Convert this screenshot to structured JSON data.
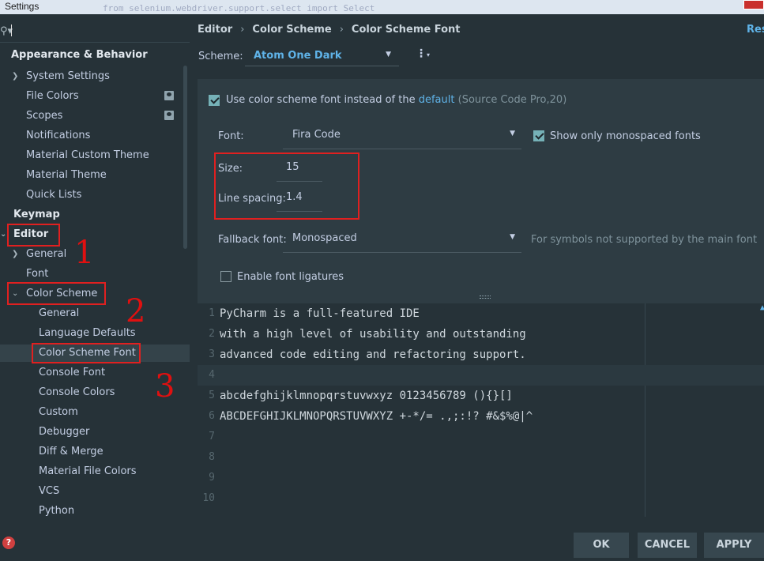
{
  "window": {
    "title": "Settings",
    "background_code": "from selenium.webdriver.support.select import Select"
  },
  "search": {
    "value": "",
    "icon": "search-icon"
  },
  "sidebar": {
    "items": [
      {
        "label": "Appearance & Behavior"
      },
      {
        "label": "System Settings"
      },
      {
        "label": "File Colors"
      },
      {
        "label": "Scopes"
      },
      {
        "label": "Notifications"
      },
      {
        "label": "Material Custom Theme"
      },
      {
        "label": "Material Theme"
      },
      {
        "label": "Quick Lists"
      },
      {
        "label": "Keymap"
      },
      {
        "label": "Editor"
      },
      {
        "label": "General"
      },
      {
        "label": "Font"
      },
      {
        "label": "Color Scheme"
      },
      {
        "label": "General"
      },
      {
        "label": "Language Defaults"
      },
      {
        "label": "Color Scheme Font"
      },
      {
        "label": "Console Font"
      },
      {
        "label": "Console Colors"
      },
      {
        "label": "Custom"
      },
      {
        "label": "Debugger"
      },
      {
        "label": "Diff & Merge"
      },
      {
        "label": "Material File Colors"
      },
      {
        "label": "VCS"
      },
      {
        "label": "Python"
      }
    ]
  },
  "annotations": [
    "1",
    "2",
    "3"
  ],
  "breadcrumb": {
    "items": [
      "Editor",
      "Color Scheme",
      "Color Scheme Font"
    ],
    "separator": "›"
  },
  "reset_label": "Res",
  "scheme": {
    "label": "Scheme:",
    "value": "Atom One Dark"
  },
  "use_scheme_font": {
    "checked": true,
    "text_before": "Use color scheme font instead of the",
    "link": "default",
    "text_after": "(Source Code Pro,20)"
  },
  "font": {
    "label": "Font:",
    "value": "Fira Code"
  },
  "show_monospaced": {
    "checked": true,
    "label": "Show only monospaced fonts"
  },
  "size": {
    "label": "Size:",
    "value": "15"
  },
  "line_spacing": {
    "label": "Line spacing:",
    "value": "1.4"
  },
  "fallback": {
    "label": "Fallback font:",
    "value": "Monospaced",
    "hint": "For symbols not supported by the main font"
  },
  "ligatures": {
    "checked": false,
    "label": "Enable font ligatures"
  },
  "preview": {
    "lines": [
      {
        "num": "1",
        "text": "PyCharm is a full-featured IDE"
      },
      {
        "num": "2",
        "text": "with a high level of usability and outstanding"
      },
      {
        "num": "3",
        "text": "advanced code editing and refactoring support."
      },
      {
        "num": "4",
        "text": ""
      },
      {
        "num": "5",
        "text": "abcdefghijklmnopqrstuvwxyz 0123456789 (){}[]"
      },
      {
        "num": "6",
        "text": "ABCDEFGHIJKLMNOPQRSTUVWXYZ +-*/= .,;:!? #&$%@|^"
      },
      {
        "num": "7",
        "text": ""
      },
      {
        "num": "8",
        "text": ""
      },
      {
        "num": "9",
        "text": ""
      },
      {
        "num": "10",
        "text": ""
      }
    ]
  },
  "buttons": {
    "ok": "OK",
    "cancel": "CANCEL",
    "apply": "APPLY"
  },
  "colors": {
    "background": "#263238",
    "accent": "#5fb3e8",
    "annotation": "#e02020",
    "checkbox": "#75b1b7"
  }
}
